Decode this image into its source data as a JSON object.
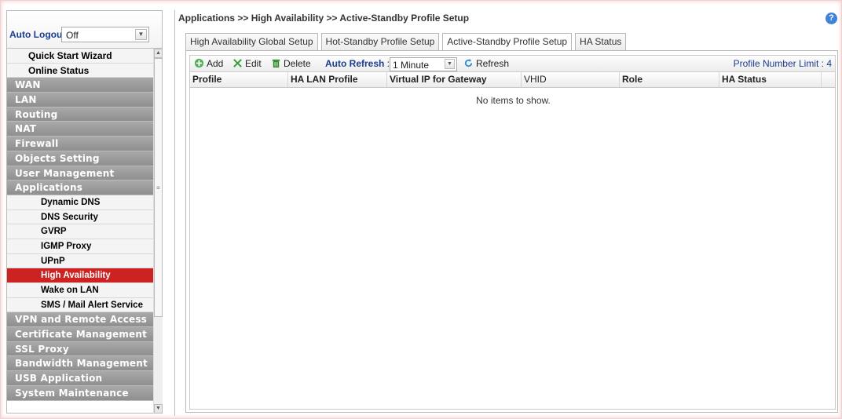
{
  "sidebar": {
    "auto_logout_label": "Auto Logout :",
    "auto_logout_value": "Off",
    "items": [
      {
        "label": "Quick Start Wizard",
        "kind": "light"
      },
      {
        "label": "Online Status",
        "kind": "light"
      },
      {
        "label": "WAN",
        "kind": "cat"
      },
      {
        "label": "LAN",
        "kind": "cat"
      },
      {
        "label": "Routing",
        "kind": "cat"
      },
      {
        "label": "NAT",
        "kind": "cat"
      },
      {
        "label": "Firewall",
        "kind": "cat"
      },
      {
        "label": "Objects Setting",
        "kind": "cat"
      },
      {
        "label": "User Management",
        "kind": "cat"
      },
      {
        "label": "Applications",
        "kind": "cat"
      },
      {
        "label": "Dynamic DNS",
        "kind": "sub"
      },
      {
        "label": "DNS Security",
        "kind": "sub"
      },
      {
        "label": "GVRP",
        "kind": "sub"
      },
      {
        "label": "IGMP Proxy",
        "kind": "sub"
      },
      {
        "label": "UPnP",
        "kind": "sub"
      },
      {
        "label": "High Availability",
        "kind": "sub",
        "active": true
      },
      {
        "label": "Wake on LAN",
        "kind": "sub"
      },
      {
        "label": "SMS / Mail Alert Service",
        "kind": "sub"
      },
      {
        "label": "VPN and Remote Access",
        "kind": "cat"
      },
      {
        "label": "Certificate Management",
        "kind": "cat"
      },
      {
        "label": "SSL Proxy",
        "kind": "cat"
      },
      {
        "label": "Bandwidth Management",
        "kind": "cat"
      },
      {
        "label": "USB Application",
        "kind": "cat"
      },
      {
        "label": "System Maintenance",
        "kind": "cat"
      }
    ]
  },
  "main": {
    "breadcrumb": "Applications >> High Availability >> Active-Standby Profile Setup",
    "tabs": [
      {
        "label": "High Availability Global Setup"
      },
      {
        "label": "Hot-Standby Profile Setup"
      },
      {
        "label": "Active-Standby Profile Setup",
        "selected": true
      },
      {
        "label": "HA Status"
      }
    ],
    "toolbar": {
      "add": "Add",
      "edit": "Edit",
      "delete": "Delete",
      "auto_refresh": "Auto Refresh",
      "auto_refresh_value": "1 Minute",
      "refresh": "Refresh",
      "profile_limit": "Profile Number Limit : 4"
    },
    "columns": [
      "Profile",
      "HA LAN Profile",
      "Virtual IP for Gateway",
      "VHID",
      "Role",
      "HA Status"
    ],
    "empty_text": "No items to show."
  },
  "colors": {
    "active_item": "#cc2222",
    "category_bg": "#999999",
    "accent_text": "#1a3d8f"
  }
}
